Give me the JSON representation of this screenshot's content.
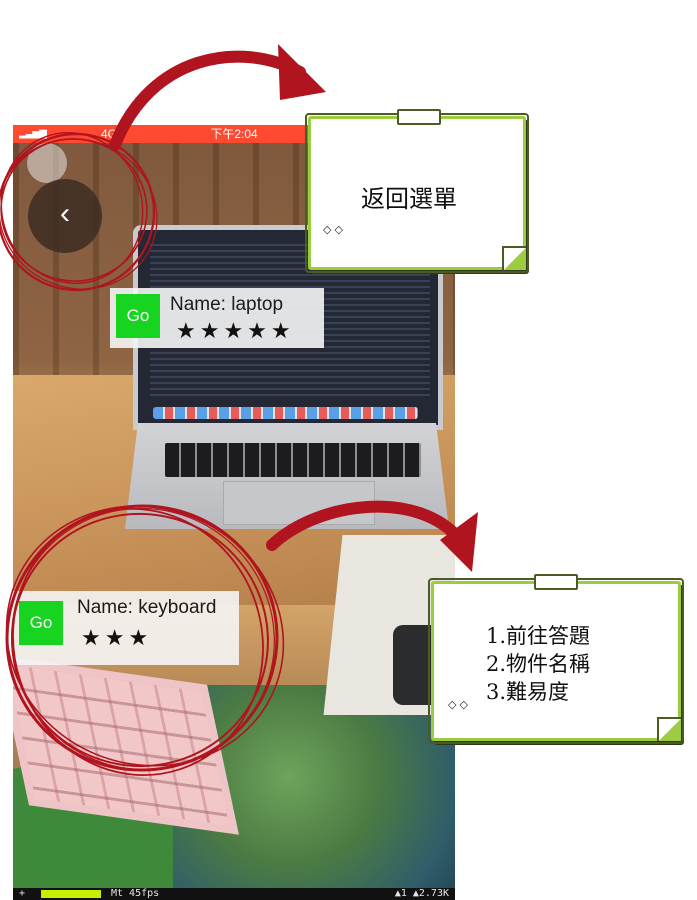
{
  "status_bar": {
    "carrier": "4G",
    "time": "下午2:04"
  },
  "back_button": {
    "glyph": "‹"
  },
  "ar_labels": [
    {
      "go_label": "Go",
      "name": "Name: laptop",
      "stars": "★★★★★"
    },
    {
      "go_label": "Go",
      "name": "Name: keyboard",
      "stars": "★★★"
    }
  ],
  "debug_bar": {
    "plus": "+",
    "fps": "Mt 45fps",
    "net": "▲1 ▲2.73K"
  },
  "notes": [
    {
      "lines": [
        "返回選單"
      ]
    },
    {
      "lines": [
        "1.前往答題",
        "2.物件名稱",
        "3.難易度"
      ]
    }
  ],
  "colors": {
    "annotation_red": "#b0141e",
    "note_border": "#9ccc42",
    "go_button": "#17d421",
    "status_bar": "#ff4a31"
  }
}
